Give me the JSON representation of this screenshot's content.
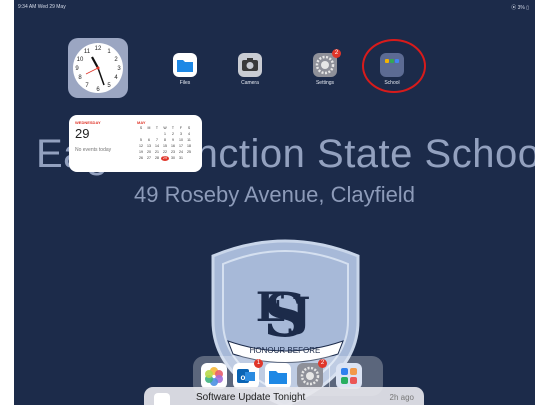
{
  "status_bar": {
    "time_date": "9:34 AM  Wed 29 May",
    "battery": "⦿ 3% ▯"
  },
  "wallpaper": {
    "title": "Eagle Junction State School",
    "address": "49 Roseby Avenue, Clayfield",
    "crest_motto": "HONOUR BEFORE"
  },
  "apps": [
    {
      "label": "Files",
      "icon": "folder-icon"
    },
    {
      "label": "Camera",
      "icon": "camera-icon"
    },
    {
      "label": "Settings",
      "icon": "gear-icon",
      "badge": "2"
    },
    {
      "label": "School",
      "icon": "app-folder-icon"
    }
  ],
  "calendar": {
    "weekday": "WEDNESDAY",
    "day": "29",
    "no_events": "No events today",
    "month": "MAY",
    "weekday_headers": [
      "S",
      "M",
      "T",
      "W",
      "T",
      "F",
      "S"
    ],
    "grid": [
      "",
      "",
      "",
      "1",
      "2",
      "3",
      "4",
      "5",
      "6",
      "7",
      "8",
      "9",
      "10",
      "11",
      "12",
      "13",
      "14",
      "15",
      "16",
      "17",
      "18",
      "19",
      "20",
      "21",
      "22",
      "23",
      "24",
      "25",
      "26",
      "27",
      "28",
      "29",
      "30",
      "31",
      ""
    ],
    "today": "29"
  },
  "dock": {
    "apps": [
      {
        "icon": "photos-icon"
      },
      {
        "icon": "outlook-icon",
        "badge": "1"
      },
      {
        "icon": "folder-icon"
      },
      {
        "icon": "gear-icon",
        "badge": "2"
      },
      {
        "icon": "app-library-icon"
      }
    ]
  },
  "notification": {
    "title": "Software Update Tonight",
    "time": "2h ago"
  },
  "colors": {
    "background": "#1c2b4a",
    "accent_red": "#e0362a",
    "highlight": "#d81b1b"
  }
}
